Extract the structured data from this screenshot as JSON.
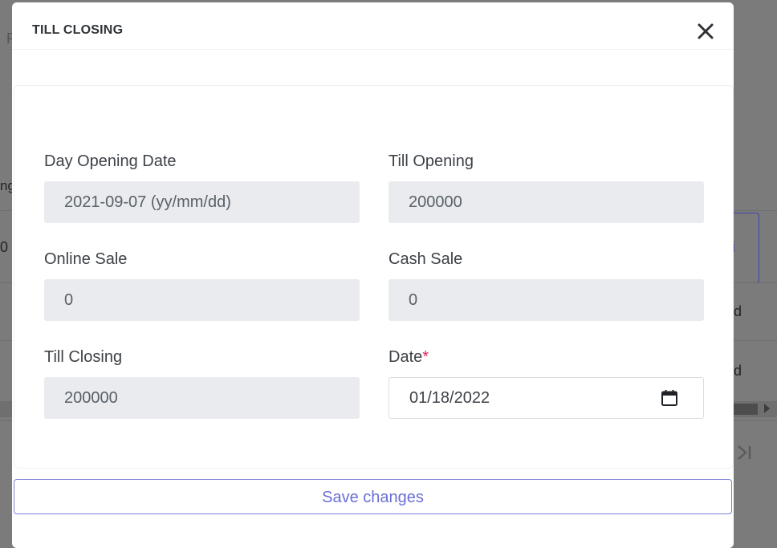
{
  "modal": {
    "title": "TILL CLOSING",
    "close_icon": "close-icon",
    "save_label": "Save changes"
  },
  "form": {
    "day_opening_date": {
      "label": "Day Opening Date",
      "value": "2021-09-07 (yy/mm/dd)"
    },
    "till_opening": {
      "label": "Till Opening",
      "value": "200000"
    },
    "online_sale": {
      "label": "Online Sale",
      "value": "0"
    },
    "cash_sale": {
      "label": "Cash Sale",
      "value": "0"
    },
    "till_closing": {
      "label": "Till Closing",
      "value": "200000"
    },
    "date": {
      "label": "Date",
      "required_mark": "*",
      "value": "01/18/2022",
      "icon": "calendar-icon"
    }
  },
  "background": {
    "frag_top": "F",
    "frag_left_1": "ng",
    "frag_left_2": "0",
    "frag_right_1": "i",
    "frag_right_2": "d",
    "frag_right_3": "d",
    "last_page_icon": "last-page-icon"
  },
  "colors": {
    "accent": "#6b6fd4",
    "required": "#e0245e",
    "input_bg": "#e9ebee",
    "overlay": "#7b7b7b"
  }
}
